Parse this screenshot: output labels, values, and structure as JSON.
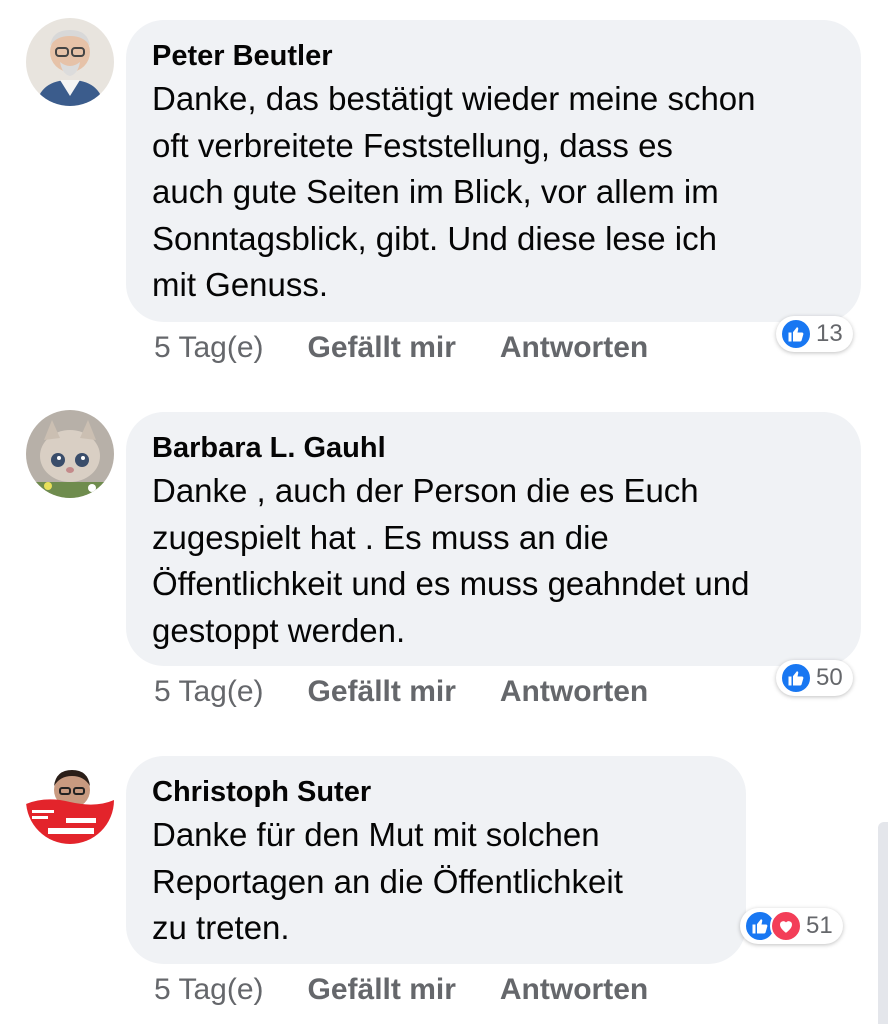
{
  "comments": [
    {
      "author": "Peter Beutler",
      "text": "Danke, das bestätigt wieder meine schon\noft  verbreitete Feststellung, dass es\nauch gute Seiten im Blick, vor allem im\nSonntagsblick, gibt. Und diese lese ich\nmit Genuss.",
      "time": "5 Tag(e)",
      "like_label": "Gefällt mir",
      "reply_label": "Antworten",
      "reaction_count": "13",
      "reactions": [
        "like-icon"
      ]
    },
    {
      "author": "Barbara L. Gauhl",
      "text": "Danke , auch der Person die es Euch\nzugespielt hat . Es muss an die\nÖffentlichkeit und es muss geahndet und\ngestoppt werden.",
      "time": "5 Tag(e)",
      "like_label": "Gefällt mir",
      "reply_label": "Antworten",
      "reaction_count": "50",
      "reactions": [
        "like-icon"
      ]
    },
    {
      "author": "Christoph Suter",
      "text": "Danke für den Mut mit solchen\nReportagen an die Öffentlichkeit\nzu treten.",
      "time": "5 Tag(e)",
      "like_label": "Gefällt mir",
      "reply_label": "Antworten",
      "reaction_count": "51",
      "reactions": [
        "like-icon",
        "love-icon"
      ]
    }
  ],
  "colors": {
    "bubble": "#f0f2f5",
    "meta_text": "#65676b",
    "like_blue": "#1877f2",
    "love_red": "#f33e58"
  }
}
